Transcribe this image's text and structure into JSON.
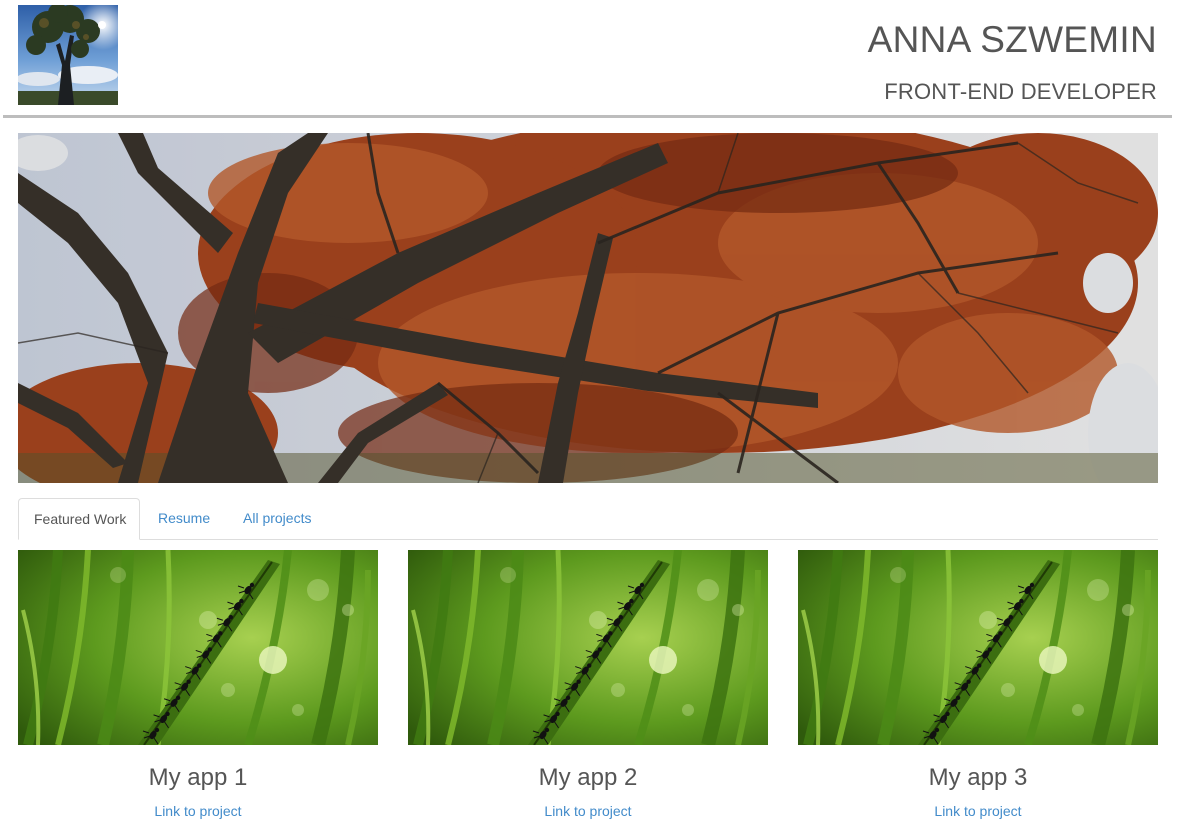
{
  "header": {
    "name": "ANNA SZWEMIN",
    "role": "FRONT-END DEVELOPER",
    "avatar_icon": "tree-photo-avatar"
  },
  "hero": {
    "image_icon": "autumn-tree-photo"
  },
  "tabs": [
    {
      "label": "Featured Work",
      "active": true
    },
    {
      "label": "Resume",
      "active": false
    },
    {
      "label": "All projects",
      "active": false
    }
  ],
  "projects": [
    {
      "title": "My app 1",
      "link_label": "Link to project",
      "image_icon": "ants-on-grass-photo"
    },
    {
      "title": "My app 2",
      "link_label": "Link to project",
      "image_icon": "ants-on-grass-photo"
    },
    {
      "title": "My app 3",
      "link_label": "Link to project",
      "image_icon": "ants-on-grass-photo"
    }
  ],
  "colors": {
    "link": "#428bca",
    "text": "#555555",
    "divider": "#bdbdbd"
  }
}
